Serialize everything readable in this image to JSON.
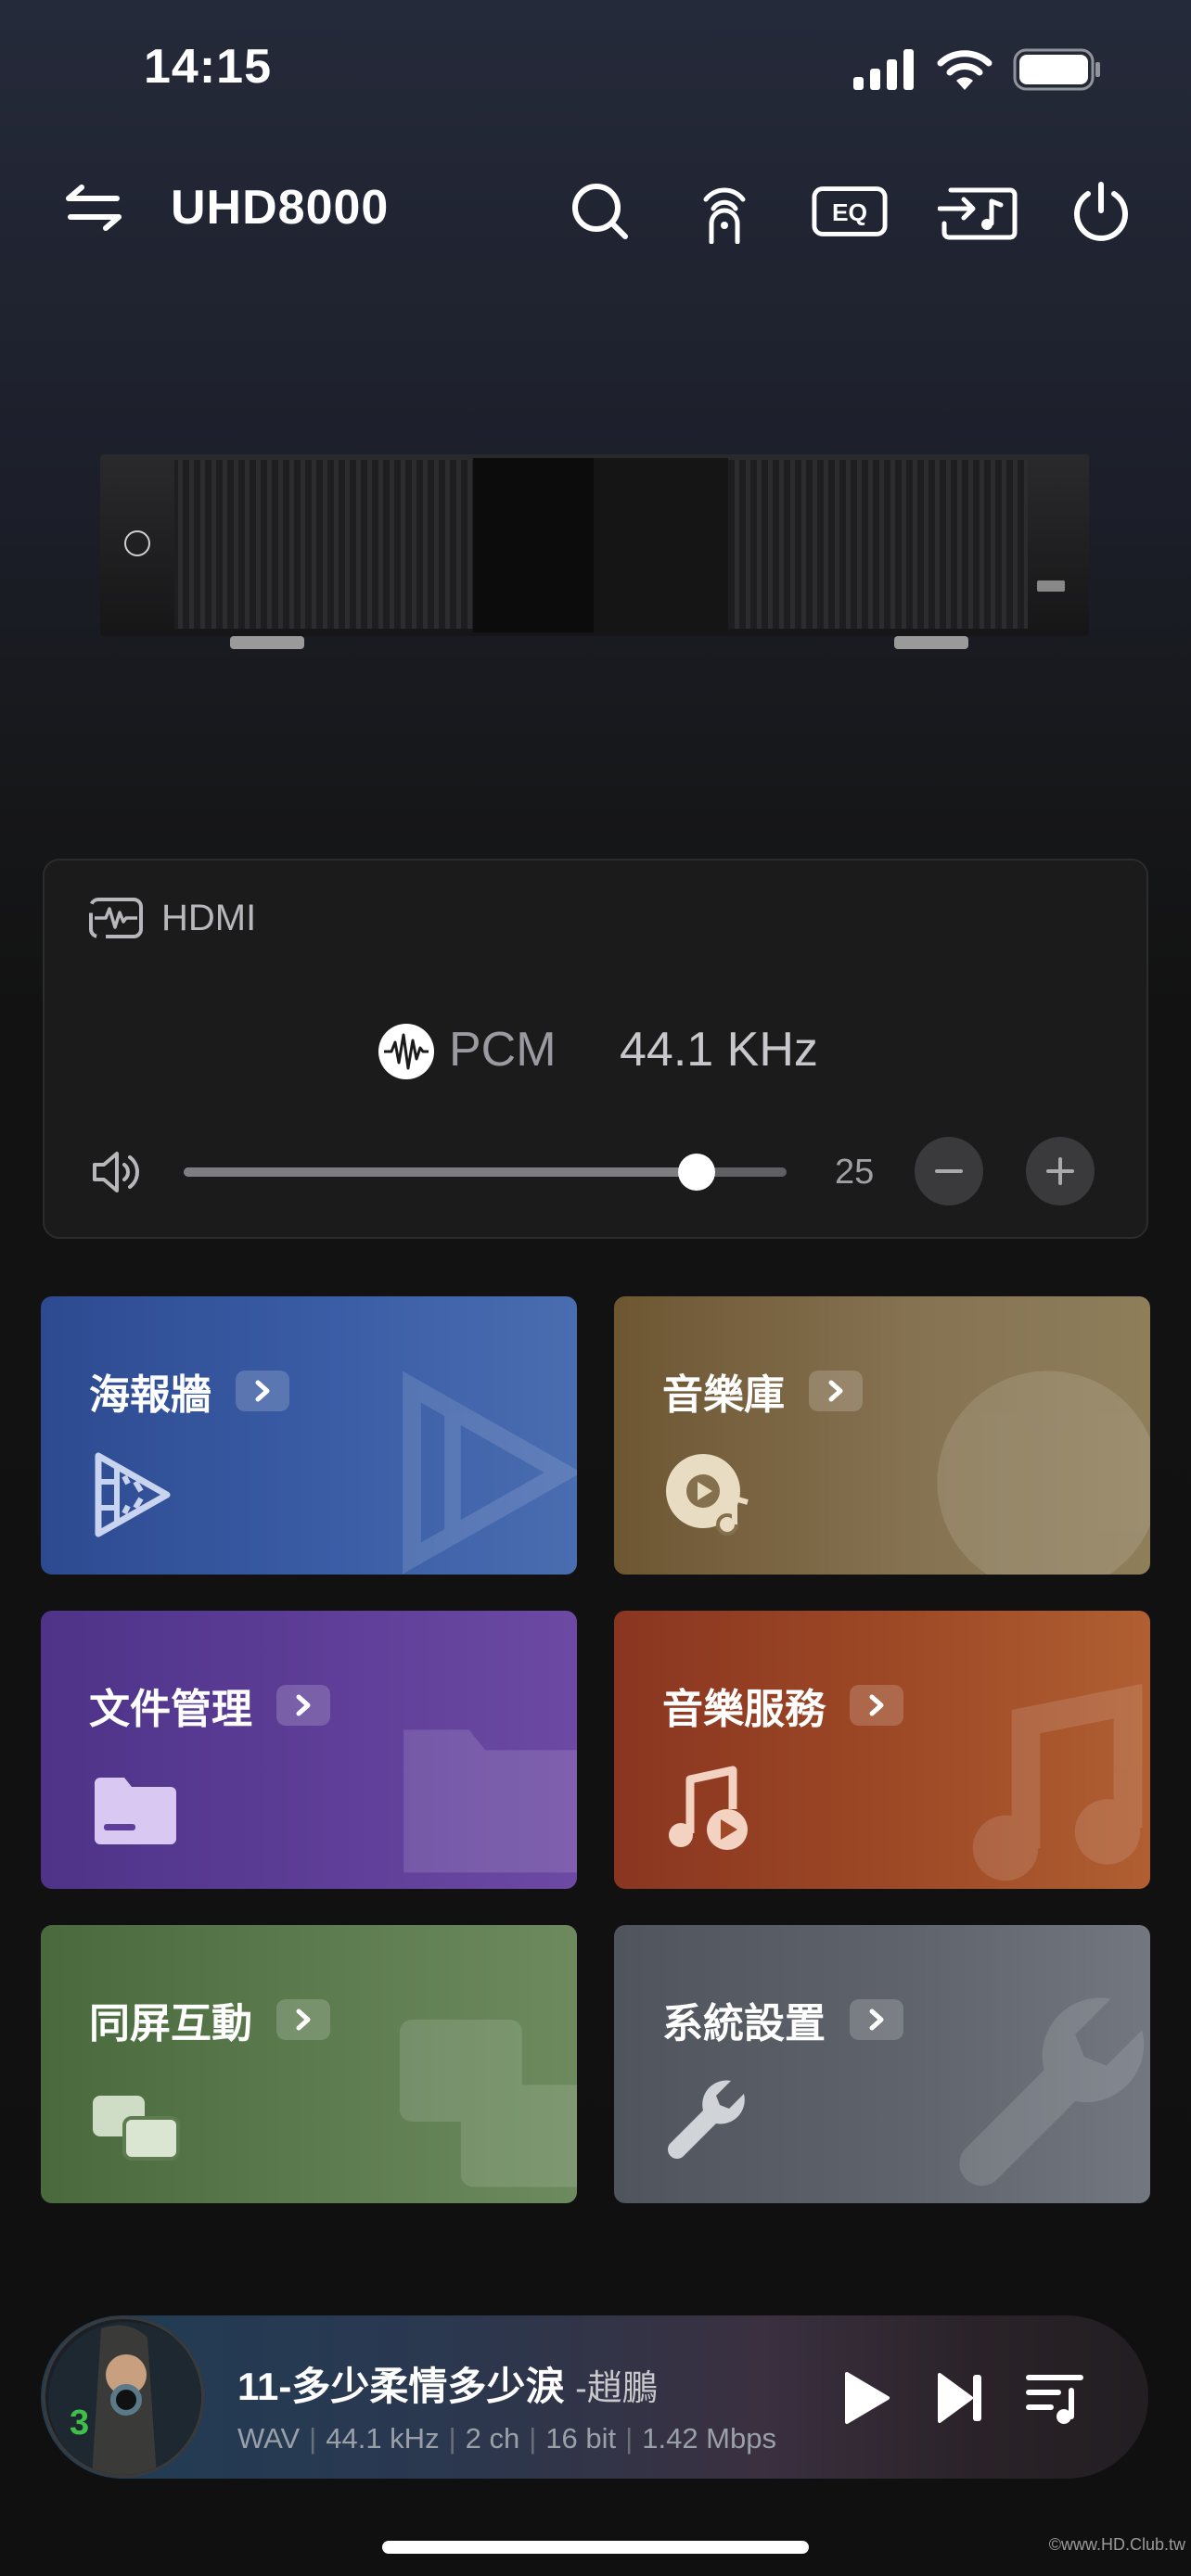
{
  "status": {
    "time": "14:15"
  },
  "header": {
    "device_name": "UHD8000",
    "eq_label": "EQ"
  },
  "input_panel": {
    "source": "HDMI",
    "format": "PCM",
    "sample_rate": "44.1 KHz",
    "volume": 25,
    "volume_label": "25",
    "volume_fraction": 0.85
  },
  "tiles": [
    {
      "label": "海報牆",
      "icon": "film-play-icon"
    },
    {
      "label": "音樂庫",
      "icon": "disc-music-icon"
    },
    {
      "label": "文件管理",
      "icon": "folder-icon"
    },
    {
      "label": "音樂服務",
      "icon": "music-note-play-icon"
    },
    {
      "label": "同屏互動",
      "icon": "screen-mirror-icon"
    },
    {
      "label": "系統設置",
      "icon": "wrench-icon"
    }
  ],
  "now_playing": {
    "title": "11-多少柔情多少淚",
    "artist": "-趙鵬",
    "meta": [
      "WAV",
      "44.1 kHz",
      "2 ch",
      "16 bit",
      "1.42 Mbps"
    ]
  },
  "watermark": "©www.HD.Club.tw",
  "colors": {
    "background": "#121212",
    "panel": "#1b1b1c",
    "accent_white": "#ffffff"
  }
}
